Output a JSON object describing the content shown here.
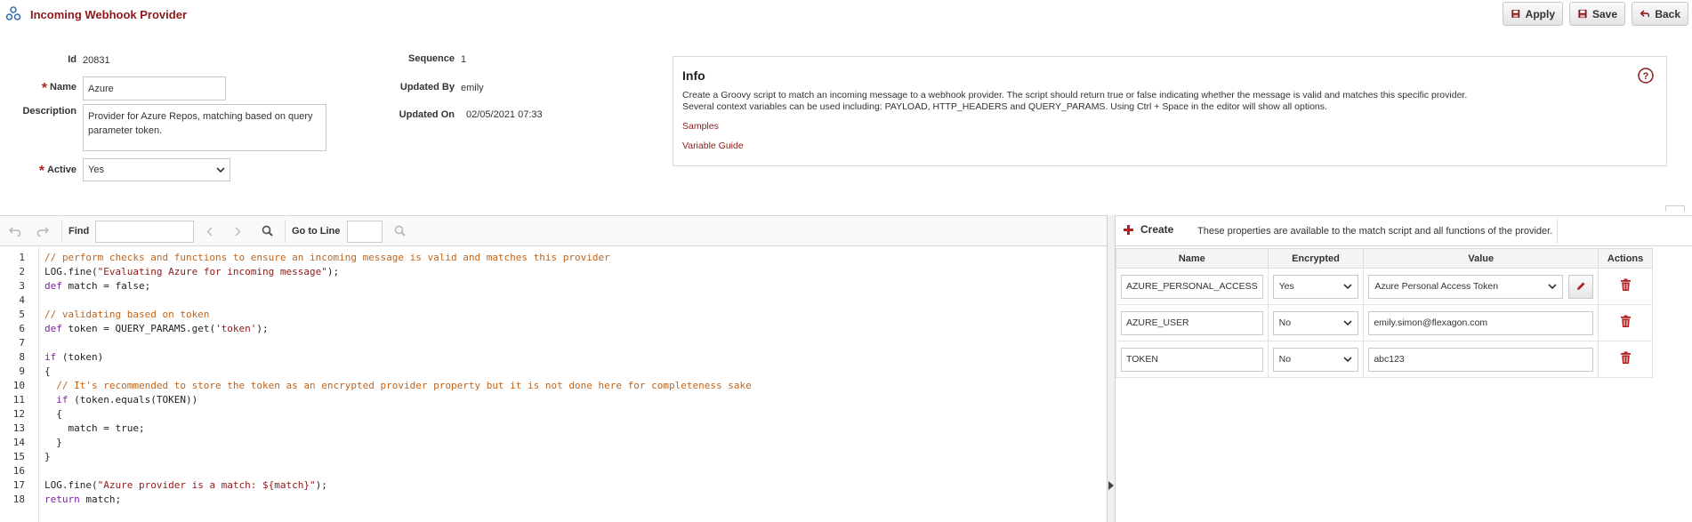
{
  "header": {
    "title": "Incoming Webhook Provider",
    "apply_label": "Apply",
    "save_label": "Save",
    "back_label": "Back"
  },
  "form": {
    "id_label": "Id",
    "id_value": "20831",
    "name_label": "Name",
    "name_value": "Azure",
    "description_label": "Description",
    "description_value": "Provider for Azure Repos, matching based on query parameter token.",
    "active_label": "Active",
    "active_value": "Yes",
    "sequence_label": "Sequence",
    "sequence_value": "1",
    "updated_by_label": "Updated By",
    "updated_by_value": "emily",
    "updated_on_label": "Updated On",
    "updated_on_value": "02/05/2021 07:33"
  },
  "info": {
    "title": "Info",
    "line1": "Create a Groovy script to match an incoming message to a webhook provider. The script should return true or false indicating whether the message is valid and matches this specific provider.",
    "line2": "Several context variables can be used including: PAYLOAD, HTTP_HEADERS and QUERY_PARAMS. Using Ctrl + Space in the editor will show all options.",
    "samples_link": "Samples",
    "variable_guide_link": "Variable Guide"
  },
  "editor": {
    "find_label": "Find",
    "goto_label": "Go to Line",
    "lines": [
      {
        "n": "1",
        "parts": [
          {
            "t": "// perform checks and functions to ensure an incoming message is valid and matches this provider",
            "c": "cm"
          }
        ]
      },
      {
        "n": "2",
        "parts": [
          {
            "t": "LOG.fine(",
            "c": ""
          },
          {
            "t": "\"Evaluating Azure for incoming message\"",
            "c": "str"
          },
          {
            "t": ");",
            "c": ""
          }
        ]
      },
      {
        "n": "3",
        "parts": [
          {
            "t": "def",
            "c": "kw"
          },
          {
            "t": " match = false;",
            "c": ""
          }
        ]
      },
      {
        "n": "4",
        "parts": []
      },
      {
        "n": "5",
        "parts": [
          {
            "t": "// validating based on token",
            "c": "cm"
          }
        ]
      },
      {
        "n": "6",
        "parts": [
          {
            "t": "def",
            "c": "kw"
          },
          {
            "t": " token = QUERY_PARAMS.get(",
            "c": ""
          },
          {
            "t": "'token'",
            "c": "str"
          },
          {
            "t": ");",
            "c": ""
          }
        ]
      },
      {
        "n": "7",
        "parts": []
      },
      {
        "n": "8",
        "parts": [
          {
            "t": "if",
            "c": "kw"
          },
          {
            "t": " (token)",
            "c": ""
          }
        ]
      },
      {
        "n": "9",
        "parts": [
          {
            "t": "{",
            "c": ""
          }
        ]
      },
      {
        "n": "10",
        "parts": [
          {
            "t": "  // It's recommended to store the token as an encrypted provider property but it is not done here for completeness sake",
            "c": "cm"
          }
        ]
      },
      {
        "n": "11",
        "parts": [
          {
            "t": "  ",
            "c": ""
          },
          {
            "t": "if",
            "c": "kw"
          },
          {
            "t": " (token.equals(TOKEN))",
            "c": ""
          }
        ]
      },
      {
        "n": "12",
        "parts": [
          {
            "t": "  {",
            "c": ""
          }
        ]
      },
      {
        "n": "13",
        "parts": [
          {
            "t": "    match = true;",
            "c": ""
          }
        ]
      },
      {
        "n": "14",
        "parts": [
          {
            "t": "  }",
            "c": ""
          }
        ]
      },
      {
        "n": "15",
        "parts": [
          {
            "t": "}",
            "c": ""
          }
        ]
      },
      {
        "n": "16",
        "parts": []
      },
      {
        "n": "17",
        "parts": [
          {
            "t": "LOG.fine(",
            "c": ""
          },
          {
            "t": "\"Azure provider is a match: ${match}\"",
            "c": "str"
          },
          {
            "t": ");",
            "c": ""
          }
        ]
      },
      {
        "n": "18",
        "parts": [
          {
            "t": "return",
            "c": "kw"
          },
          {
            "t": " match;",
            "c": ""
          }
        ]
      }
    ]
  },
  "properties": {
    "create_label": "Create",
    "description": "These properties are available to the match script and all functions of the provider.",
    "columns": [
      "Name",
      "Encrypted",
      "Value",
      "Actions"
    ],
    "rows": [
      {
        "name": "AZURE_PERSONAL_ACCESS",
        "encrypted": "Yes",
        "value": "Azure Personal Access Token"
      },
      {
        "name": "AZURE_USER",
        "encrypted": "No",
        "value": "emily.simon@flexagon.com"
      },
      {
        "name": "TOKEN",
        "encrypted": "No",
        "value": "abc123"
      }
    ]
  },
  "colors": {
    "brand": "#8b1a1a",
    "comment": "#c0641c",
    "keyword": "#7b1fa2",
    "delete": "#b22222"
  }
}
